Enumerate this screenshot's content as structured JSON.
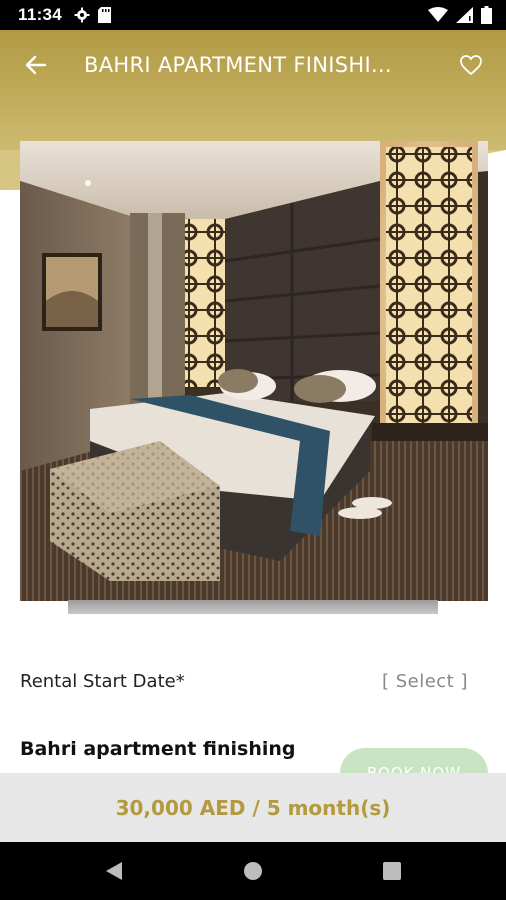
{
  "status_bar": {
    "time": "11:34",
    "left_icons": [
      "gear-icon",
      "sd-card-icon"
    ],
    "right_icons": [
      "wifi-icon",
      "signal-icon",
      "battery-icon"
    ]
  },
  "header": {
    "title": "BAHRI APARTMENT FINISHI...",
    "back_icon": "arrow-left-icon",
    "favorite_icon": "heart-outline-icon"
  },
  "hero": {
    "image_description_icon": "bedroom-photo"
  },
  "booking": {
    "start_date_label": "Rental Start Date*",
    "start_date_value": "[ Select ]",
    "product_name": "Bahri apartment finishing",
    "book_label": "BOOK NOW",
    "price": "30,000 AED / 5 month(s)"
  },
  "navigation": [
    "back-triangle-icon",
    "home-circle-icon",
    "recents-square-icon"
  ],
  "colors": {
    "accent_gold": "#b39a3e",
    "header_gold": "#c2ad5c",
    "book_button": "#c8e4c2",
    "price_bar_bg": "#e7e7e7"
  }
}
